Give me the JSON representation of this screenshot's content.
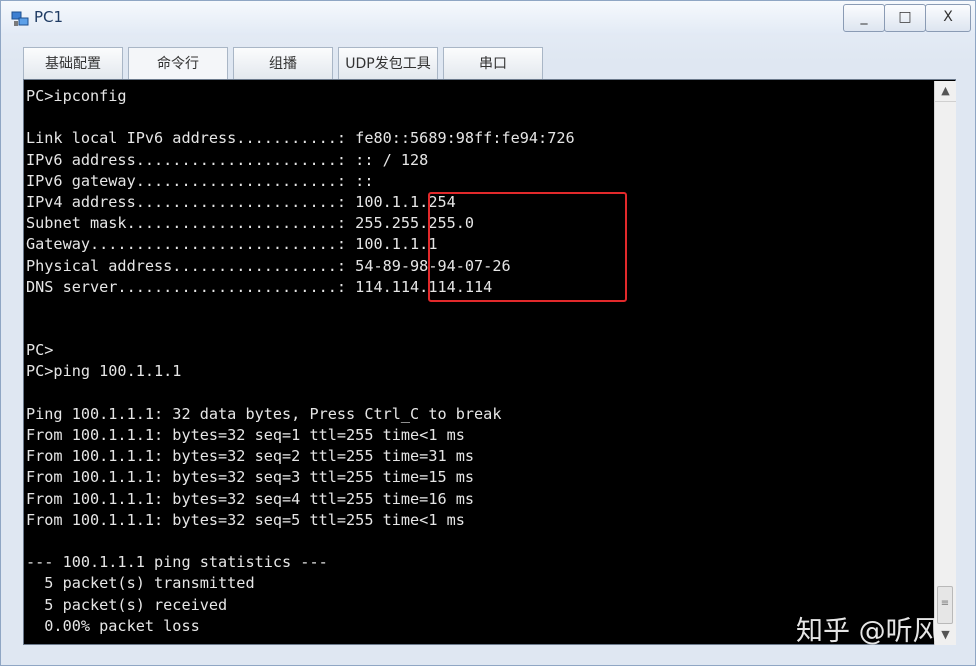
{
  "window": {
    "title": "PC1",
    "minimize_label": "_",
    "maximize_label": "□",
    "close_label": "X"
  },
  "tabs": [
    {
      "label": "基础配置"
    },
    {
      "label": "命令行",
      "active": true
    },
    {
      "label": "组播"
    },
    {
      "label": "UDP发包工具"
    },
    {
      "label": "串口"
    }
  ],
  "terminal": {
    "lines": [
      "PC>ipconfig",
      "",
      "Link local IPv6 address...........: fe80::5689:98ff:fe94:726",
      "IPv6 address......................: :: / 128",
      "IPv6 gateway......................: ::",
      "IPv4 address......................: 100.1.1.254",
      "Subnet mask.......................: 255.255.255.0",
      "Gateway...........................: 100.1.1.1",
      "Physical address..................: 54-89-98-94-07-26",
      "DNS server........................: 114.114.114.114",
      "",
      "",
      "PC>",
      "PC>ping 100.1.1.1",
      "",
      "Ping 100.1.1.1: 32 data bytes, Press Ctrl_C to break",
      "From 100.1.1.1: bytes=32 seq=1 ttl=255 time<1 ms",
      "From 100.1.1.1: bytes=32 seq=2 ttl=255 time=31 ms",
      "From 100.1.1.1: bytes=32 seq=3 ttl=255 time=15 ms",
      "From 100.1.1.1: bytes=32 seq=4 ttl=255 time=16 ms",
      "From 100.1.1.1: bytes=32 seq=5 ttl=255 time<1 ms",
      "",
      "--- 100.1.1.1 ping statistics ---",
      "  5 packet(s) transmitted",
      "  5 packet(s) received",
      "  0.00% packet loss"
    ],
    "background_color": "#000000",
    "text_color": "#e6e6e6",
    "highlight_color": "#e2292b"
  },
  "scrollbar": {
    "up_icon": "▲",
    "down_icon": "▼",
    "thumb_grip": "≡"
  },
  "watermark": "知乎 @听风"
}
